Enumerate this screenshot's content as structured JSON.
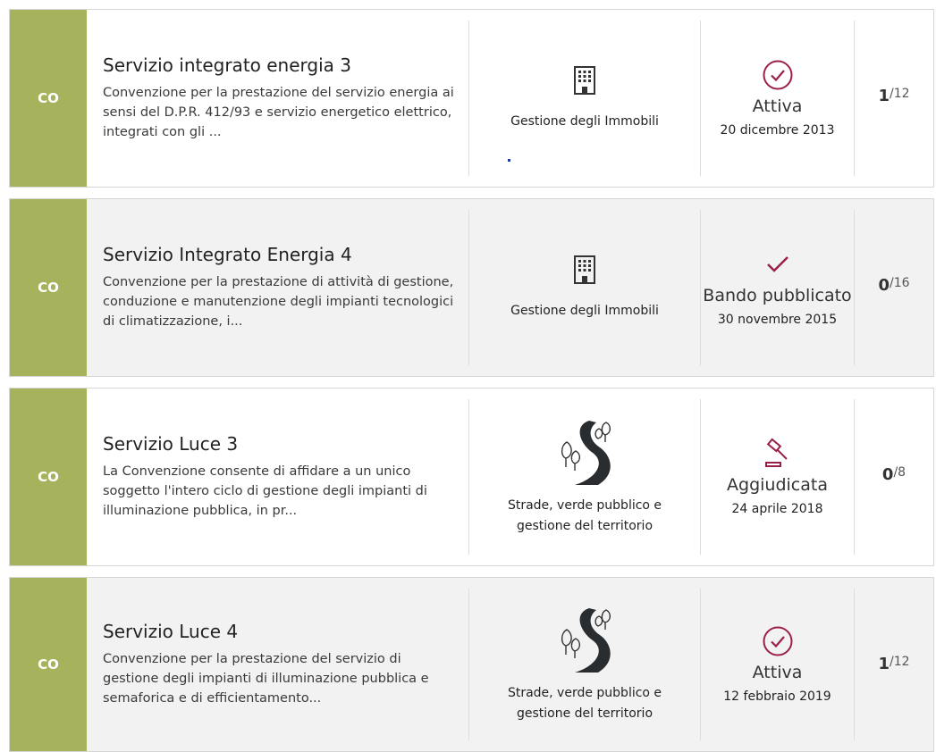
{
  "colors": {
    "type_band": "#a6b35c",
    "status_accent": "#9b2048"
  },
  "items": [
    {
      "type": "CO",
      "title": "Servizio integrato energia 3",
      "description": "Convenzione per la prestazione del servizio energia ai sensi del D.P.R. 412/93 e servizio energetico elettrico, integrati con gli ...",
      "category": "Gestione degli Immobili",
      "category_icon": "building-icon",
      "status": "Attiva",
      "status_icon": "check-circle-icon",
      "date": "20 dicembre 2013",
      "count": "1",
      "total": "/12"
    },
    {
      "type": "CO",
      "title": "Servizio Integrato Energia 4",
      "description": "Convenzione per la prestazione di attività di gestione, conduzione e manutenzione degli impianti tecnologici di climatizzazione, i...",
      "category": "Gestione degli Immobili",
      "category_icon": "building-icon",
      "status": "Bando pubblicato",
      "status_icon": "checkmark-icon",
      "date": "30 novembre 2015",
      "count": "0",
      "total": "/16"
    },
    {
      "type": "CO",
      "title": "Servizio Luce 3",
      "description": "La Convenzione consente di affidare a un unico soggetto l'intero ciclo di gestione degli impianti di illuminazione pubblica, in pr...",
      "category": "Strade, verde pubblico e gestione del territorio",
      "category_icon": "road-trees-icon",
      "status": "Aggiudicata",
      "status_icon": "gavel-icon",
      "date": "24 aprile 2018",
      "count": "0",
      "total": "/8"
    },
    {
      "type": "CO",
      "title": "Servizio Luce 4",
      "description": "Convenzione per la prestazione del servizio di gestione degli impianti di illuminazione pubblica e semaforica e di efficientamento...",
      "category": "Strade, verde pubblico e gestione del territorio",
      "category_icon": "road-trees-icon",
      "status": "Attiva",
      "status_icon": "check-circle-icon",
      "date": "12 febbraio 2019",
      "count": "1",
      "total": "/12"
    }
  ]
}
